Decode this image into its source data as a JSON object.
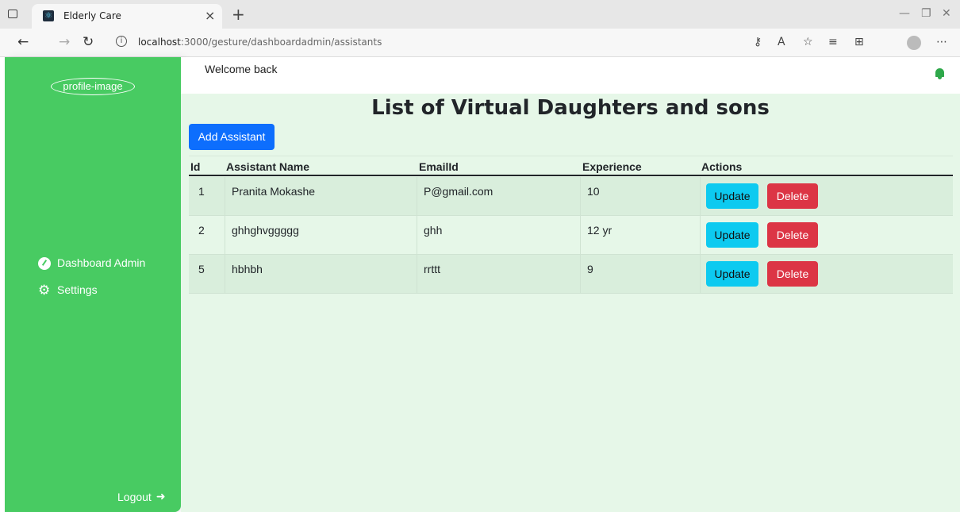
{
  "browser": {
    "tab_title": "Elderly Care",
    "url_host": "localhost",
    "url_path": ":3000/gesture/dashboardadmin/assistants"
  },
  "sidebar": {
    "profile_image_alt": "profile-image",
    "items": [
      {
        "label": "Dashboard Admin",
        "icon": "gauge-icon"
      },
      {
        "label": "Settings",
        "icon": "cogs-icon"
      }
    ],
    "logout_label": "Logout"
  },
  "topbar": {
    "welcome": "Welcome back"
  },
  "main": {
    "title": "List of Virtual Daughters and sons",
    "add_button": "Add Assistant",
    "table": {
      "headers": [
        "Id",
        "Assistant Name",
        "EmailId",
        "Experience",
        "Actions"
      ],
      "rows": [
        {
          "id": "1",
          "name": "Pranita Mokashe",
          "email": "P@gmail.com",
          "experience": "10"
        },
        {
          "id": "2",
          "name": "ghhghvggggg",
          "email": "ghh",
          "experience": "12 yr"
        },
        {
          "id": "5",
          "name": "hbhbh",
          "email": "rrttt",
          "experience": "9"
        }
      ],
      "update_label": "Update",
      "delete_label": "Delete"
    }
  },
  "colors": {
    "sidebar": "#48cb62",
    "content_bg": "#e6f7e8",
    "primary": "#0d6efd",
    "info": "#0dcaf0",
    "danger": "#dc3545"
  }
}
